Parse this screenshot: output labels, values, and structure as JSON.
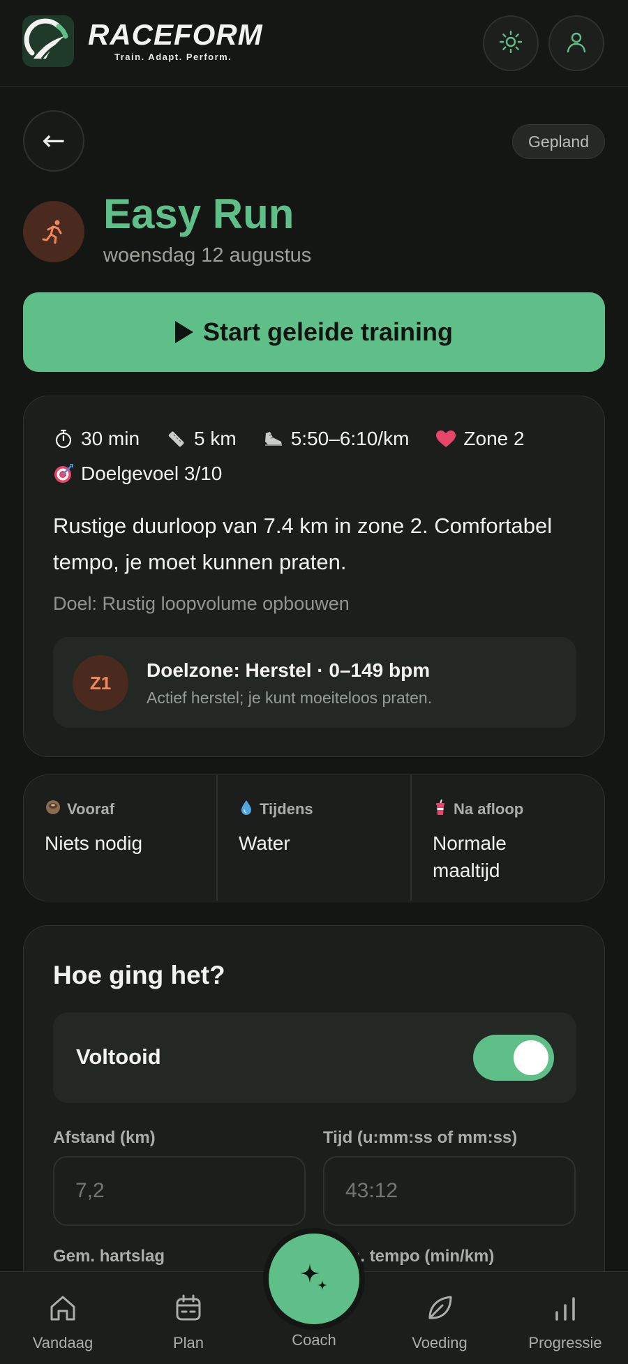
{
  "app": {
    "brand": "RACEFORM",
    "tagline": "Train. Adapt. Perform.",
    "colors": {
      "accent": "#5FBF88",
      "background": "#141614",
      "card": "#1B1E1B",
      "zone": "#F0895A"
    }
  },
  "header": {
    "theme_icon": "sun-icon",
    "profile_icon": "user-icon"
  },
  "status": "Gepland",
  "workout": {
    "title": "Easy Run",
    "date": "woensdag 12 augustus",
    "start_label": "Start geleide training",
    "stats": {
      "duration": "30 min",
      "distance": "5 km",
      "pace": "5:50–6:10/km",
      "zone": "Zone 2",
      "feel": "Doelgevoel 3/10"
    },
    "description": "Rustige duurloop van 7.4 km in zone 2. Comfortabel tempo, je moet kunnen praten.",
    "goal": "Doel: Rustig loopvolume opbouwen",
    "target_zone": {
      "badge": "Z1",
      "title": "Doelzone: Herstel · 0–149 bpm",
      "subtitle": "Actief herstel; je kunt moeiteloos praten."
    }
  },
  "nutrition": {
    "before": {
      "label": "Vooraf",
      "value": "Niets nodig"
    },
    "during": {
      "label": "Tijdens",
      "value": "Water"
    },
    "after": {
      "label": "Na afloop",
      "value": "Normale maaltijd"
    }
  },
  "feedback": {
    "title": "Hoe ging het?",
    "completed_label": "Voltooid",
    "completed": true,
    "distance_label": "Afstand (km)",
    "distance_placeholder": "7,2",
    "time_label": "Tijd (u:mm:ss of mm:ss)",
    "time_placeholder": "43:12",
    "hr_label": "Gem. hartslag",
    "pace_label": "Gem. tempo (min/km)"
  },
  "nav": {
    "today": "Vandaag",
    "plan": "Plan",
    "coach": "Coach",
    "nutrition": "Voeding",
    "progress": "Progressie"
  }
}
